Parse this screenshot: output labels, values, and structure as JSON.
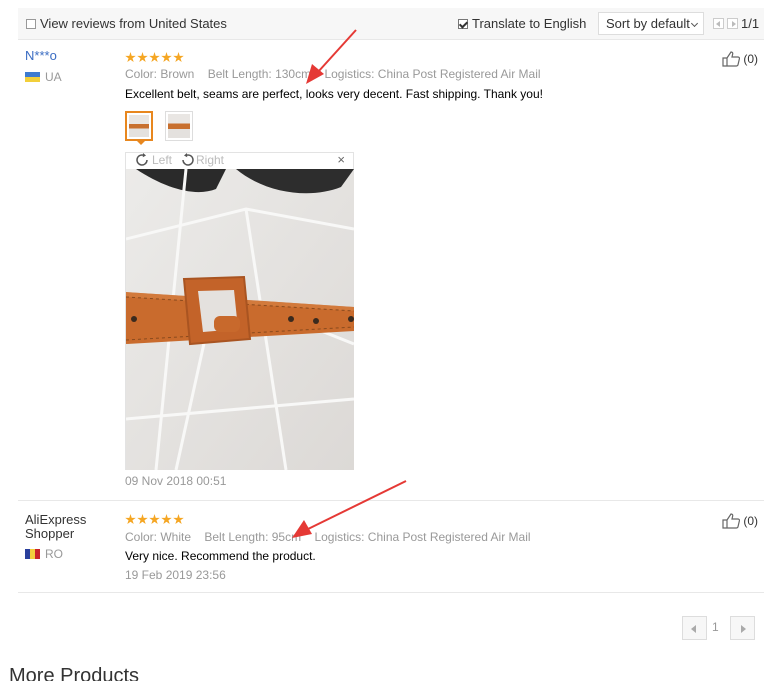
{
  "toolbar": {
    "view_reviews_label": "View reviews from United States",
    "translate_label": "Translate to English",
    "sort_label": "Sort by default",
    "page_count": "1/1"
  },
  "reviews": [
    {
      "user": "N***o",
      "country": "UA",
      "rating": 5,
      "color": "Color: Brown",
      "belt_length": "Belt Length: 130cm",
      "logistics": "Logistics: China Post Registered Air Mail",
      "feedback": "Excellent belt, seams are perfect, looks very decent. Fast shipping. Thank you!",
      "date": "09 Nov 2018 00:51",
      "likes": "(0)"
    },
    {
      "user_line1": "AliExpress",
      "user_line2": "Shopper",
      "country": "RO",
      "rating": 5,
      "color": "Color: White",
      "belt_length": "Belt Length: 95cm",
      "logistics": "Logistics: China Post Registered Air Mail",
      "feedback": "Very nice. Recommend the product.",
      "date": "19 Feb 2019 23:56",
      "likes": "(0)"
    }
  ],
  "viewer": {
    "rotate_left": "Left",
    "rotate_right": "Right",
    "close": "×"
  },
  "pagination": {
    "current": "1"
  },
  "more_products": "More Products",
  "colors": {
    "accent_orange": "#e8871e",
    "star": "#f5a623",
    "arrow_red": "#e53935",
    "link_blue": "#3a6cc2"
  }
}
